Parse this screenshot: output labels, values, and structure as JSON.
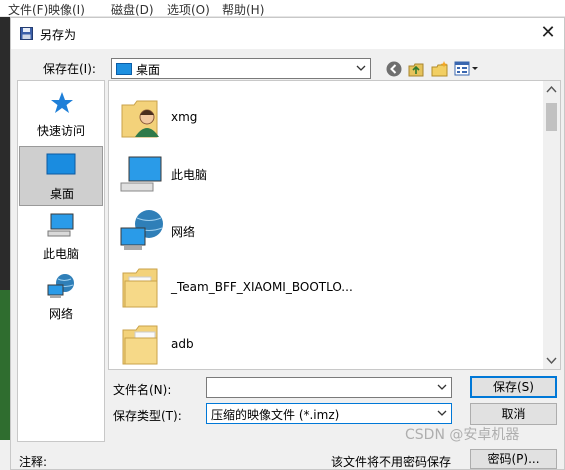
{
  "app_menu": [
    "文件(F)",
    "映像(I)",
    "磁盘(D)",
    "选项(O)",
    "帮助(H)"
  ],
  "dialog": {
    "title": "另存为",
    "close_glyph": "✕"
  },
  "save_in": {
    "label": "保存在(I):",
    "value": "桌面"
  },
  "toolbar": {
    "icons": [
      "back-icon",
      "up-folder-icon",
      "new-folder-icon",
      "view-menu-icon"
    ]
  },
  "places": [
    {
      "label": "快速访问",
      "icon": "quick-access-star-icon"
    },
    {
      "label": "桌面",
      "icon": "desktop-icon",
      "selected": true
    },
    {
      "label": "此电脑",
      "icon": "computer-icon"
    },
    {
      "label": "网络",
      "icon": "network-icon"
    }
  ],
  "files": [
    {
      "name": "xmg",
      "icon": "user-folder-icon"
    },
    {
      "name": "此电脑",
      "icon": "computer-icon"
    },
    {
      "name": "网络",
      "icon": "network-icon"
    },
    {
      "name": "_Team_BFF_XIAOMI_BOOTLO...",
      "icon": "folder-icon"
    },
    {
      "name": "adb",
      "icon": "folder-icon"
    }
  ],
  "filename": {
    "label": "文件名(N):",
    "value": ""
  },
  "filetype": {
    "label": "保存类型(T):",
    "value": "压缩的映像文件 (*.imz)"
  },
  "buttons": {
    "save": "保存(S)",
    "cancel": "取消",
    "password": "密码(P)..."
  },
  "footer": {
    "note_label": "注释:",
    "notice": "该文件将不用密码保存"
  },
  "watermark": "CSDN @安卓机器"
}
